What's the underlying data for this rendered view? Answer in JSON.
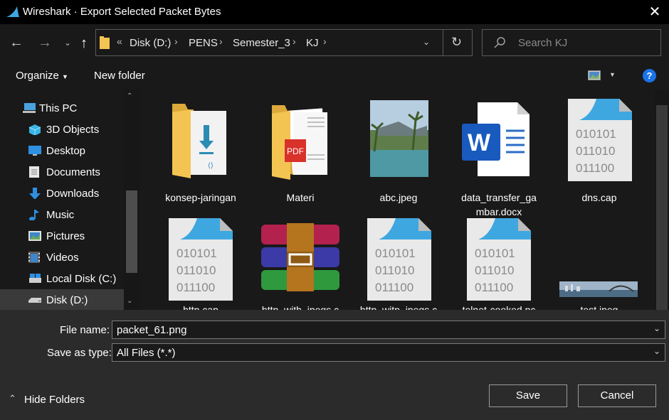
{
  "window": {
    "title": "Wireshark · Export Selected Packet Bytes",
    "close_icon": "close-icon"
  },
  "nav": {
    "back_icon": "arrow-left-icon",
    "forward_icon": "arrow-right-icon",
    "recent_icon": "chevron-down-icon",
    "up_icon": "arrow-up-icon",
    "breadcrumb": [
      "Disk (D:)",
      "PENS",
      "Semester_3",
      "KJ"
    ],
    "overflow": "«",
    "refresh_icon": "refresh-icon",
    "search_placeholder": "Search KJ"
  },
  "toolbar": {
    "organize": "Organize",
    "new_folder": "New folder",
    "help": "?"
  },
  "sidebar": {
    "items": [
      {
        "label": "This PC",
        "icon": "computer-icon"
      },
      {
        "label": "3D Objects",
        "icon": "cube-icon"
      },
      {
        "label": "Desktop",
        "icon": "desktop-icon"
      },
      {
        "label": "Documents",
        "icon": "documents-icon"
      },
      {
        "label": "Downloads",
        "icon": "download-icon"
      },
      {
        "label": "Music",
        "icon": "music-icon"
      },
      {
        "label": "Pictures",
        "icon": "pictures-icon"
      },
      {
        "label": "Videos",
        "icon": "videos-icon"
      },
      {
        "label": "Local Disk (C:)",
        "icon": "drive-icon"
      },
      {
        "label": "Disk (D:)",
        "icon": "drive-icon"
      }
    ]
  },
  "files": [
    {
      "name": "konsep-jaringan",
      "type": "folder-download"
    },
    {
      "name": "Materi",
      "type": "folder-pdf"
    },
    {
      "name": "abc.jpeg",
      "type": "image"
    },
    {
      "name_line1": "data_transfer_ga",
      "name_line2": "mbar.docx",
      "type": "word"
    },
    {
      "name": "dns.cap",
      "type": "capture"
    },
    {
      "name": "http.cap",
      "type": "capture"
    },
    {
      "name": "http_with_jpegs.c",
      "type": "archive"
    },
    {
      "name": "http_witp_jpegs.c",
      "type": "capture"
    },
    {
      "name": "telnet-cooked.pc",
      "type": "capture"
    },
    {
      "name": "test.jpeg",
      "type": "image-wide"
    }
  ],
  "binary_text": [
    "010101",
    "011010",
    "011100"
  ],
  "word_letter": "W",
  "pdf_label": "PDF",
  "form": {
    "filename_label": "File name:",
    "filename_value": "packet_61.png",
    "savetype_label": "Save as type:",
    "savetype_value": "All Files (*.*)"
  },
  "footer": {
    "hide_folders": "Hide Folders",
    "save": "Save",
    "cancel": "Cancel"
  },
  "colors": {
    "accent": "#1a73e8",
    "folder": "#f4c453",
    "word": "#185abd",
    "wireshark_fin": "#3ea7e0"
  }
}
